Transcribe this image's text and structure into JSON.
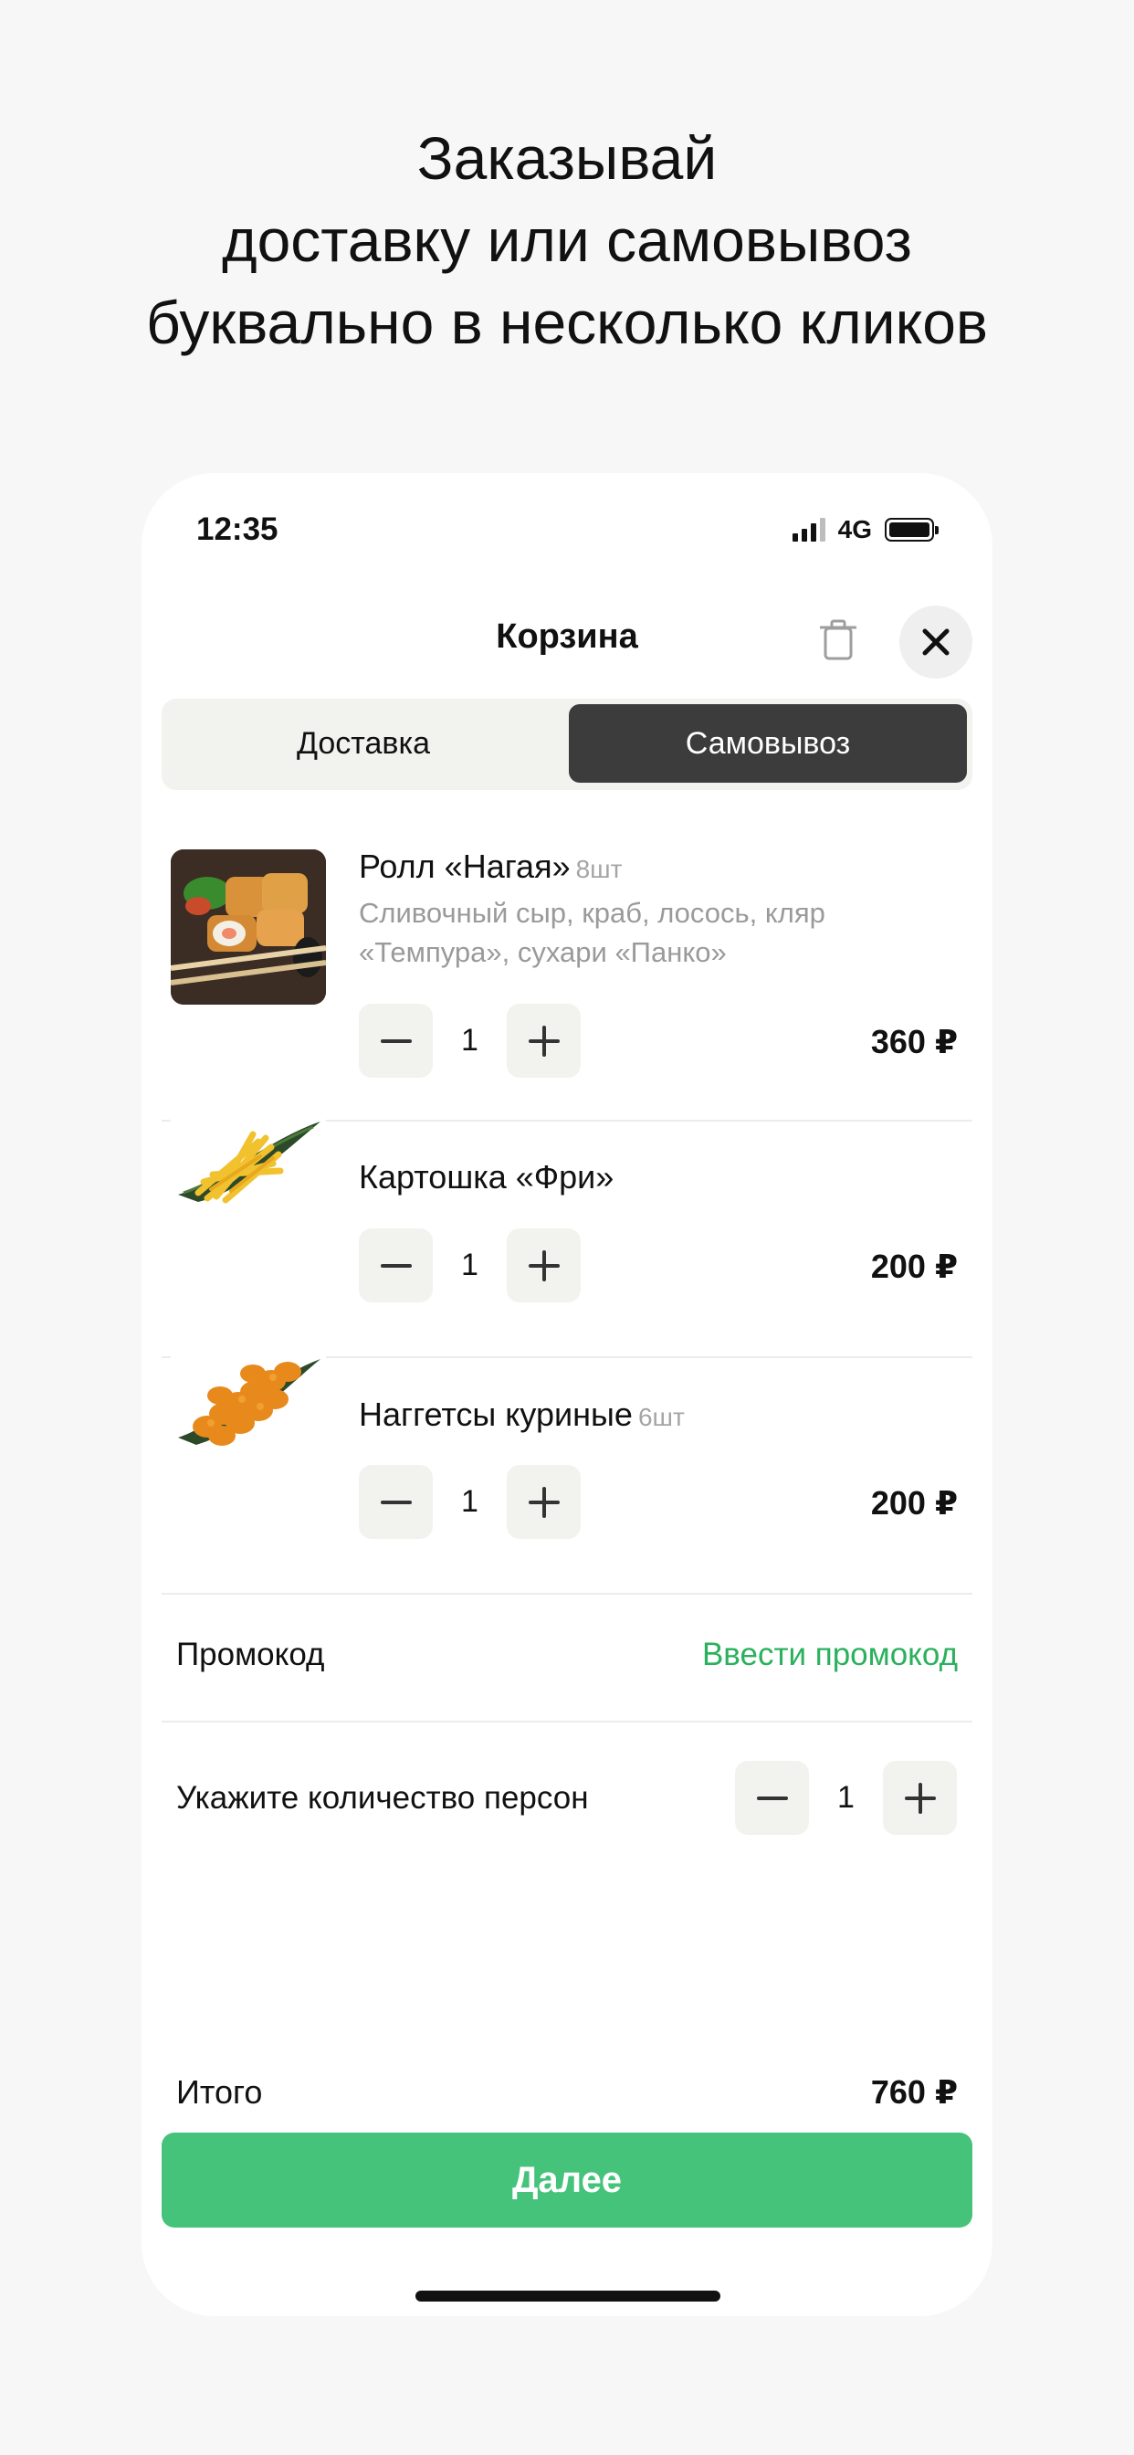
{
  "headline": {
    "line1": "Заказывай",
    "line2": "доставку или самовывоз",
    "line3": "буквально в несколько кликов"
  },
  "status_bar": {
    "time": "12:35",
    "network": "4G",
    "battery_level": 1.0
  },
  "header": {
    "title": "Корзина"
  },
  "tabs": [
    {
      "label": "Доставка",
      "active": false
    },
    {
      "label": "Самовывоз",
      "active": true
    }
  ],
  "cart_items": [
    {
      "name": "Ролл «Нагая»",
      "qty_note": "8шт",
      "description": "Сливочный сыр, краб, лосось, кляр «Темпура», сухари «Панко»",
      "quantity": "1",
      "price": "360 ₽"
    },
    {
      "name": "Картошка «Фри»",
      "qty_note": "",
      "description": "",
      "quantity": "1",
      "price": "200 ₽"
    },
    {
      "name": "Наггетсы куриные",
      "qty_note": "6шт",
      "description": "",
      "quantity": "1",
      "price": "200 ₽"
    }
  ],
  "promo": {
    "label": "Промокод",
    "action": "Ввести промокод"
  },
  "persons": {
    "label": "Укажите количество персон",
    "value": "1"
  },
  "total": {
    "label": "Итого",
    "value": "760 ₽"
  },
  "next_button": {
    "label": "Далее"
  },
  "colors": {
    "accent_green": "#46c37a",
    "link_green": "#2bb15d",
    "dark_tab": "#3c3c3c",
    "stepper_bg": "#f2f2ef"
  }
}
